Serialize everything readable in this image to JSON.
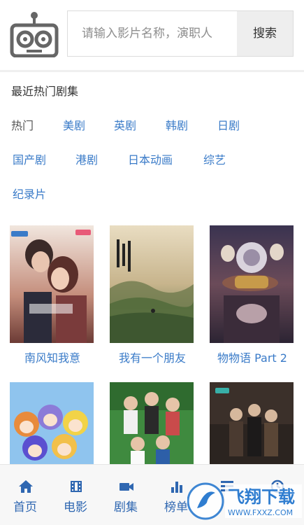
{
  "search": {
    "placeholder": "请输入影片名称，演职人",
    "button_label": "搜索"
  },
  "categories": {
    "title": "最近热门剧集",
    "tags": [
      "热门",
      "美剧",
      "英剧",
      "韩剧",
      "日剧",
      "国产剧",
      "港剧",
      "日本动画",
      "综艺",
      "纪录片"
    ]
  },
  "shows": [
    {
      "title": "南风知我意",
      "badge": "独播"
    },
    {
      "title": "我有一个朋友",
      "badge": ""
    },
    {
      "title": "物物语 Part 2",
      "badge": ""
    },
    {
      "title": "",
      "badge": ""
    },
    {
      "title": "",
      "badge": ""
    },
    {
      "title": "",
      "badge": ""
    }
  ],
  "bottom_nav": {
    "items": [
      {
        "label": "首页",
        "icon": "home-icon"
      },
      {
        "label": "电影",
        "icon": "film-icon"
      },
      {
        "label": "剧集",
        "icon": "video-camera-icon"
      },
      {
        "label": "榜单",
        "icon": "bar-chart-icon"
      },
      {
        "label": "",
        "icon": "list-icon"
      },
      {
        "label": "",
        "icon": "clock-icon"
      }
    ]
  },
  "watermark": {
    "title": "飞翔下载",
    "url": "WWW.FXXZ.COM"
  },
  "colors": {
    "link": "#3a7bc8",
    "nav": "#2f67b1",
    "watermark": "#2f7dd0"
  }
}
